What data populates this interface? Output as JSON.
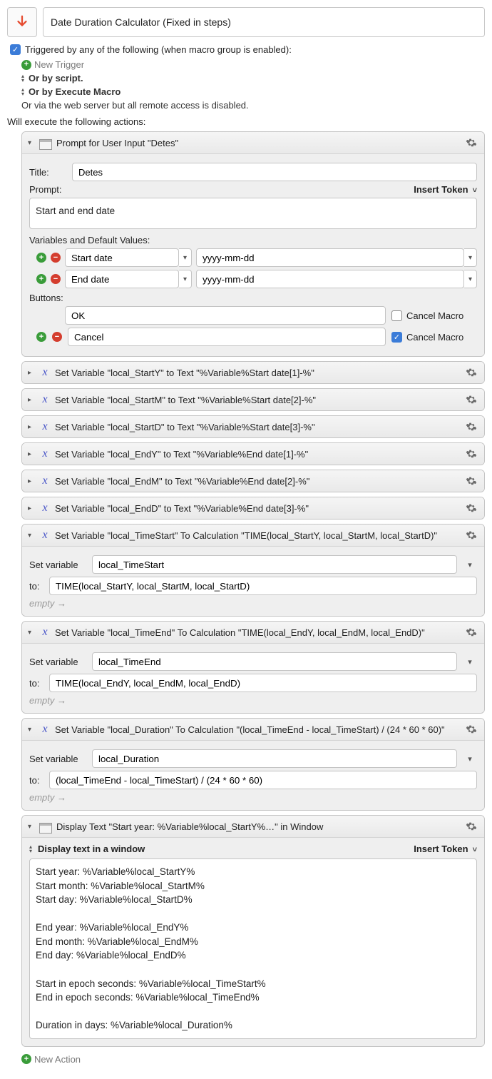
{
  "title": "Date Duration Calculator (Fixed in steps)",
  "triggers": {
    "triggered_label": "Triggered by any of the following (when macro group is enabled):",
    "new_trigger": "New Trigger",
    "or_by_script": "Or by script.",
    "or_by_execute_macro": "Or by Execute Macro",
    "or_via_web": "Or via the web server but all remote access is disabled."
  },
  "actions_header": "Will execute the following actions:",
  "prompt_action": {
    "title": "Prompt for User Input \"Detes\"",
    "title_label": "Title:",
    "title_value": "Detes",
    "prompt_label": "Prompt:",
    "insert_token": "Insert Token",
    "prompt_text": "Start and end date",
    "vars_label": "Variables and Default Values:",
    "vars": [
      {
        "name": "Start date",
        "def": "yyyy-mm-dd"
      },
      {
        "name": "End date",
        "def": "yyyy-mm-dd"
      }
    ],
    "buttons_label": "Buttons:",
    "buttons": [
      {
        "label": "OK",
        "cancel_macro": false,
        "show_pm": false
      },
      {
        "label": "Cancel",
        "cancel_macro": true,
        "show_pm": true
      }
    ],
    "cancel_macro_label": "Cancel Macro"
  },
  "set_var_collapsed": [
    "Set Variable \"local_StartY\" to Text \"%Variable%Start date[1]-%\"",
    "Set Variable \"local_StartM\" to Text \"%Variable%Start date[2]-%\"",
    "Set Variable \"local_StartD\" to Text \"%Variable%Start date[3]-%\"",
    "Set Variable \"local_EndY\" to Text \"%Variable%End date[1]-%\"",
    "Set Variable \"local_EndM\" to Text \"%Variable%End date[2]-%\"",
    "Set Variable \"local_EndD\" to Text \"%Variable%End date[3]-%\""
  ],
  "set_var_calc": [
    {
      "title": "Set Variable \"local_TimeStart\" To Calculation \"TIME(local_StartY, local_StartM, local_StartD)\"",
      "var": "local_TimeStart",
      "to": "TIME(local_StartY, local_StartM, local_StartD)"
    },
    {
      "title": "Set Variable \"local_TimeEnd\" To Calculation \"TIME(local_EndY, local_EndM, local_EndD)\"",
      "var": "local_TimeEnd",
      "to": "TIME(local_EndY, local_EndM, local_EndD)"
    },
    {
      "title": "Set Variable \"local_Duration\" To Calculation \"(local_TimeEnd - local_TimeStart) / (24 * 60 * 60)\"",
      "var": "local_Duration",
      "to": "(local_TimeEnd - local_TimeStart) / (24 * 60 * 60)"
    }
  ],
  "labels": {
    "set_variable": "Set variable",
    "to": "to:",
    "empty": "empty"
  },
  "display_action": {
    "title": "Display Text \"Start year: %Variable%local_StartY%…\" in Window",
    "mode": "Display text in a window",
    "insert_token": "Insert Token",
    "body": "Start year: %Variable%local_StartY%\nStart month: %Variable%local_StartM%\nStart day: %Variable%local_StartD%\n\nEnd year: %Variable%local_EndY%\nEnd month: %Variable%local_EndM%\nEnd day: %Variable%local_EndD%\n\nStart in epoch seconds: %Variable%local_TimeStart%\nEnd in epoch seconds: %Variable%local_TimeEnd%\n\nDuration in days: %Variable%local_Duration%"
  },
  "new_action": "New Action"
}
